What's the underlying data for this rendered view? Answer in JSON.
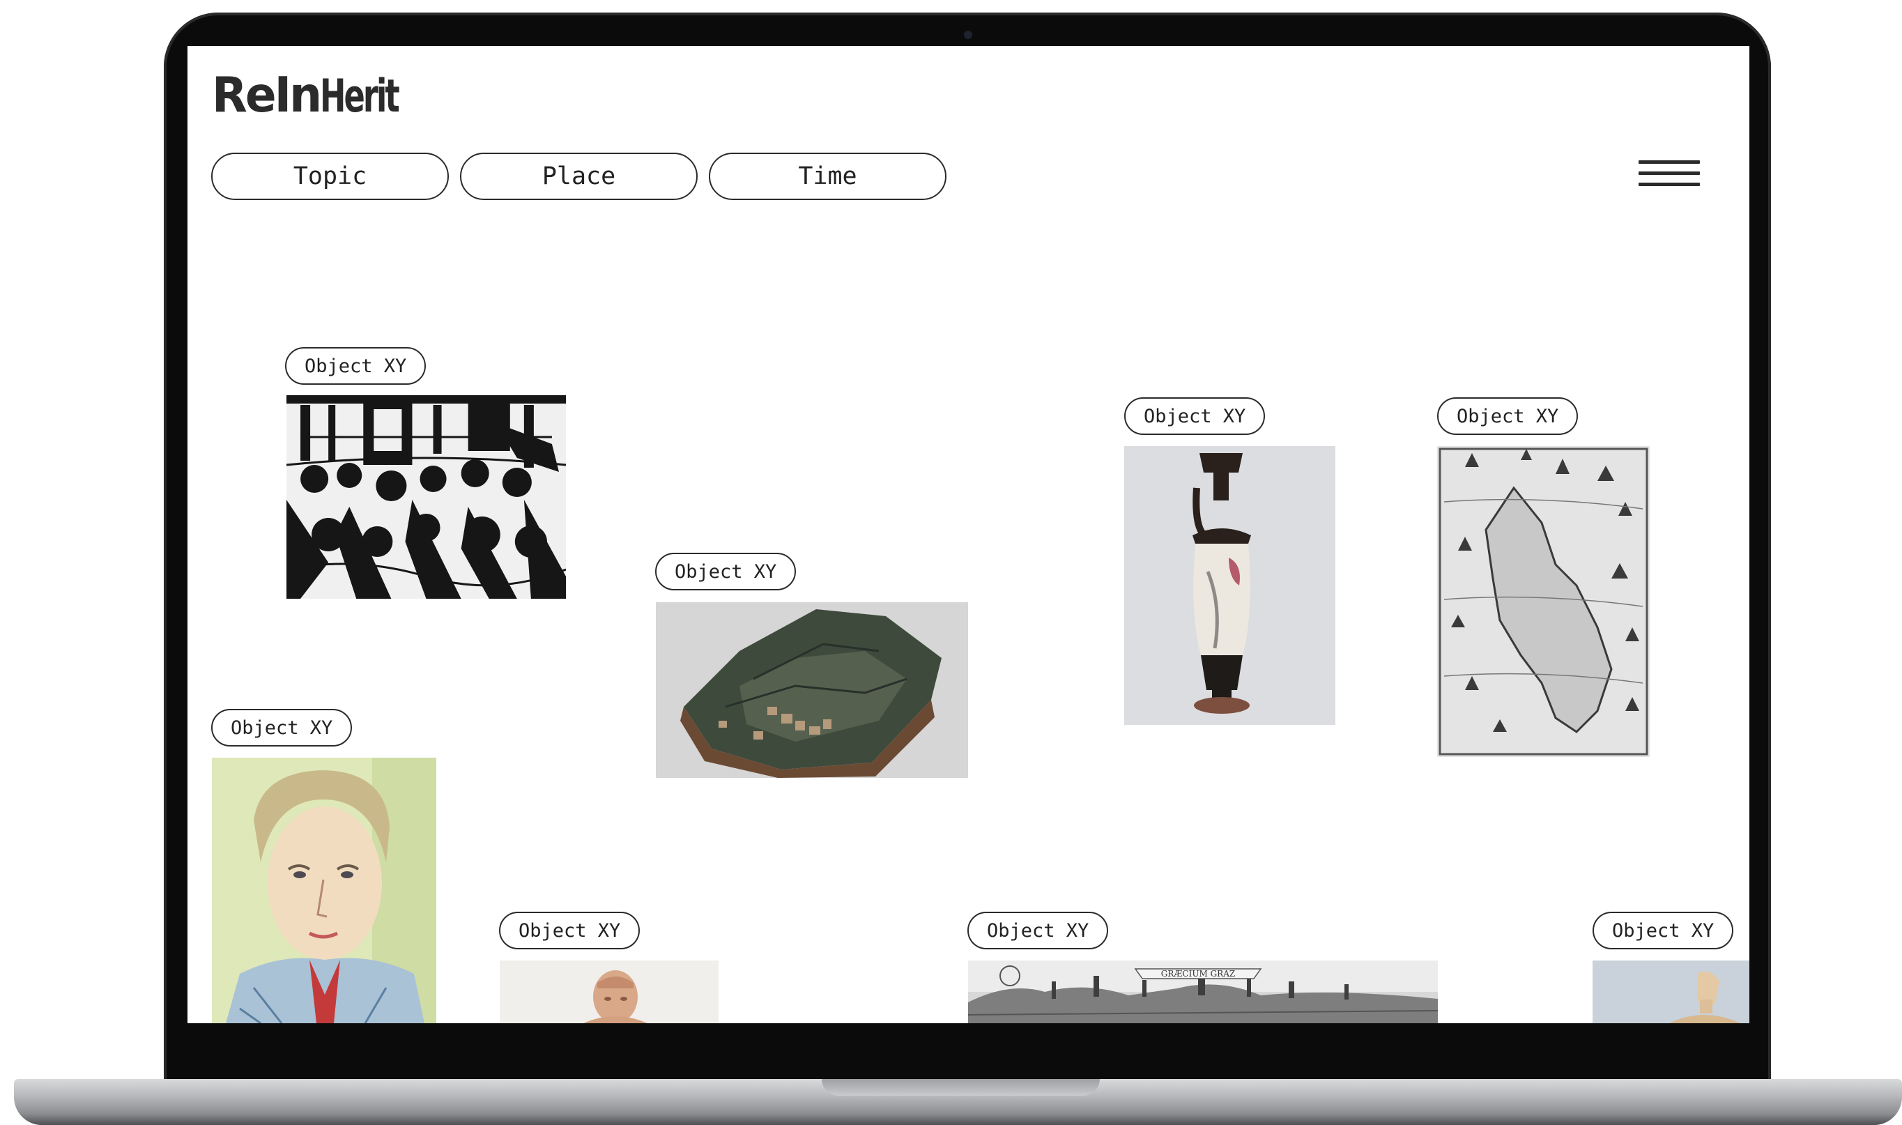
{
  "header": {
    "logo_main": "ReIn",
    "logo_tail": "Herit"
  },
  "filters": [
    {
      "label": "Topic"
    },
    {
      "label": "Place"
    },
    {
      "label": "Time"
    }
  ],
  "menu": {
    "icon": "hamburger-menu-icon"
  },
  "objects": [
    {
      "label": "Object XY",
      "image": "woodcut-crowd-scene"
    },
    {
      "label": "Object XY",
      "image": "fortress-relief-model"
    },
    {
      "label": "Object XY",
      "image": "greek-lekythos-vase"
    },
    {
      "label": "Object XY",
      "image": "engraved-island-map"
    },
    {
      "label": "Object XY",
      "image": "watercolor-portrait"
    },
    {
      "label": "Object XY",
      "image": "terracotta-figurine"
    },
    {
      "label": "Object XY",
      "image": "city-panorama-engraving"
    },
    {
      "label": "Object XY",
      "image": "cycladic-figure"
    }
  ],
  "panorama_caption": "GRÆCIUM GRAZ",
  "colors": {
    "frame": "#0b0b0c",
    "ink": "#2b2b2b",
    "screen": "#ffffff"
  }
}
